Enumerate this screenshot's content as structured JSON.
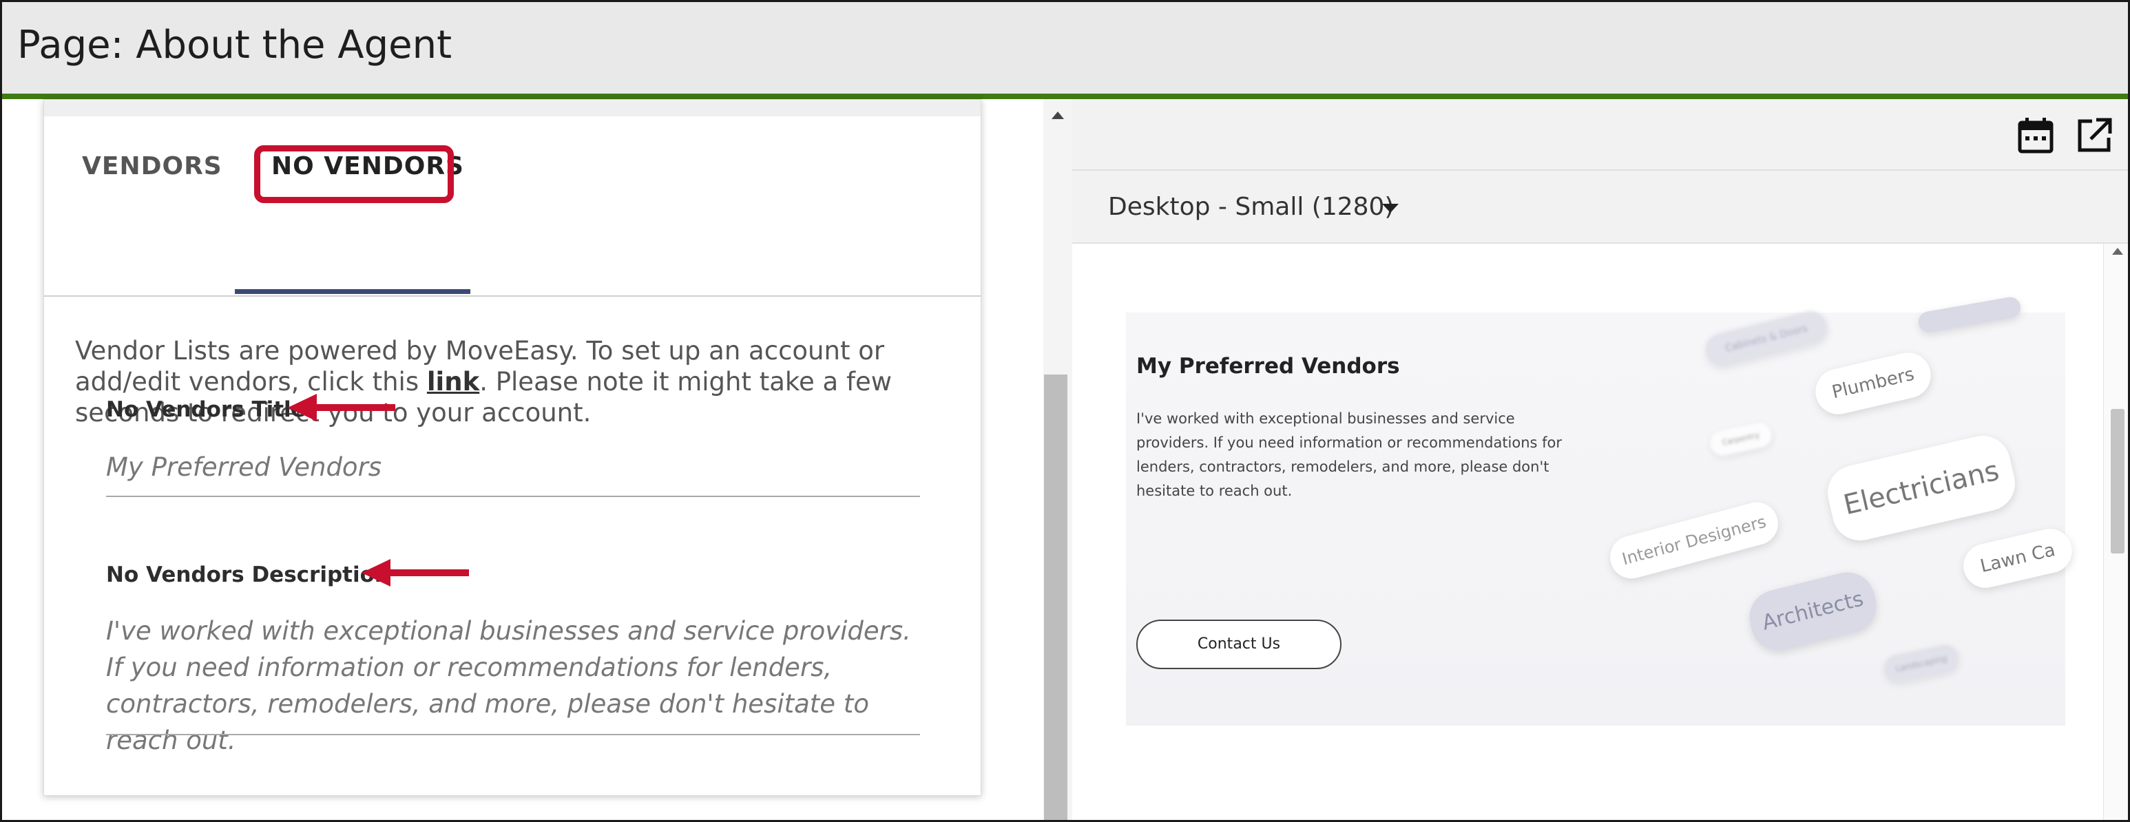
{
  "header": {
    "title": "Page: About the Agent"
  },
  "editor": {
    "tabs": [
      {
        "label": "VENDORS"
      },
      {
        "label": "NO VENDORS"
      }
    ],
    "intro": {
      "before": "Vendor Lists are powered by MoveEasy. To set up an account or add/edit vendors, click this ",
      "link": "link",
      "after": ". Please note it might take a few seconds to redirect you to your account."
    },
    "title_field": {
      "label": "No Vendors Title",
      "value": "My Preferred Vendors"
    },
    "description_field": {
      "label": "No Vendors Description",
      "value": "I've worked with exceptional businesses and service providers. If you need information or recommendations for lenders, contractors, remodelers, and more, please don't hesitate to reach out."
    }
  },
  "preview": {
    "device": "Desktop - Small (1280)",
    "heading": "My Preferred Vendors",
    "description": "I've worked with exceptional businesses and service providers. If you need information or recommendations for lenders, contractors, remodelers, and more, please don't hesitate to reach out.",
    "button": "Contact Us",
    "pills": {
      "cabinets": "Cabinets & Doors",
      "plumbers": "Plumbers",
      "carpentry": "Carpentry",
      "electricians": "Electricians",
      "interior": "Interior Designers",
      "lawn": "Lawn Ca",
      "architects": "Architects",
      "landscaping": "Landscaping"
    }
  },
  "colors": {
    "accent_green": "#3f7a12",
    "highlight_red": "#c8102e",
    "tab_underline": "#3b4a73"
  }
}
